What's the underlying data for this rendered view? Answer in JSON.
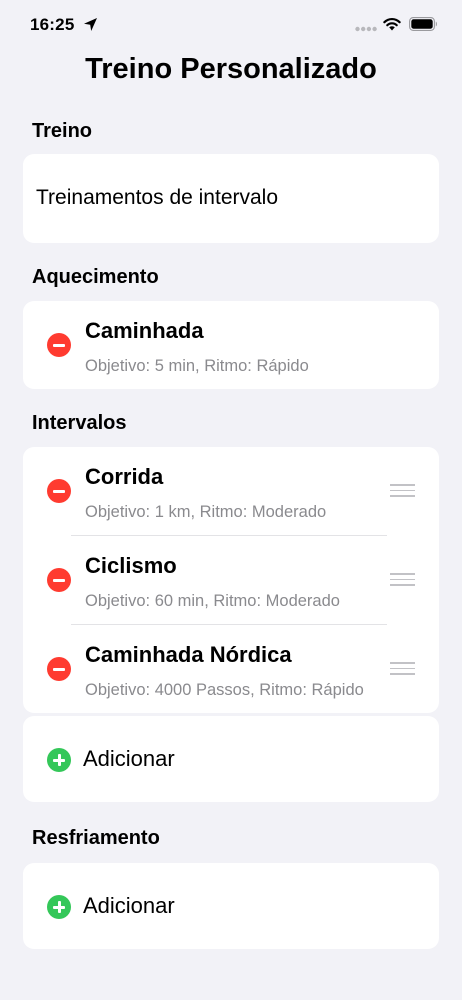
{
  "status_bar": {
    "time": "16:25"
  },
  "page": {
    "title": "Treino Personalizado"
  },
  "sections": {
    "treino": {
      "header": "Treino",
      "value": "Treinamentos de intervalo"
    },
    "aquecimento": {
      "header": "Aquecimento",
      "items": [
        {
          "title": "Caminhada",
          "subtitle": "Objetivo: 5 min, Ritmo: Rápido"
        }
      ]
    },
    "intervalos": {
      "header": "Intervalos",
      "items": [
        {
          "title": "Corrida",
          "subtitle": "Objetivo: 1 km, Ritmo: Moderado"
        },
        {
          "title": "Ciclismo",
          "subtitle": "Objetivo: 60 min, Ritmo: Moderado"
        },
        {
          "title": "Caminhada Nórdica",
          "subtitle": "Objetivo: 4000 Passos, Ritmo: Rápido"
        }
      ],
      "add_label": "Adicionar"
    },
    "resfriamento": {
      "header": "Resfriamento",
      "add_label": "Adicionar"
    }
  },
  "colors": {
    "remove": "#ff3b30",
    "add": "#34c759",
    "background": "#f2f2f7",
    "secondary_text": "#8a8a8e"
  }
}
